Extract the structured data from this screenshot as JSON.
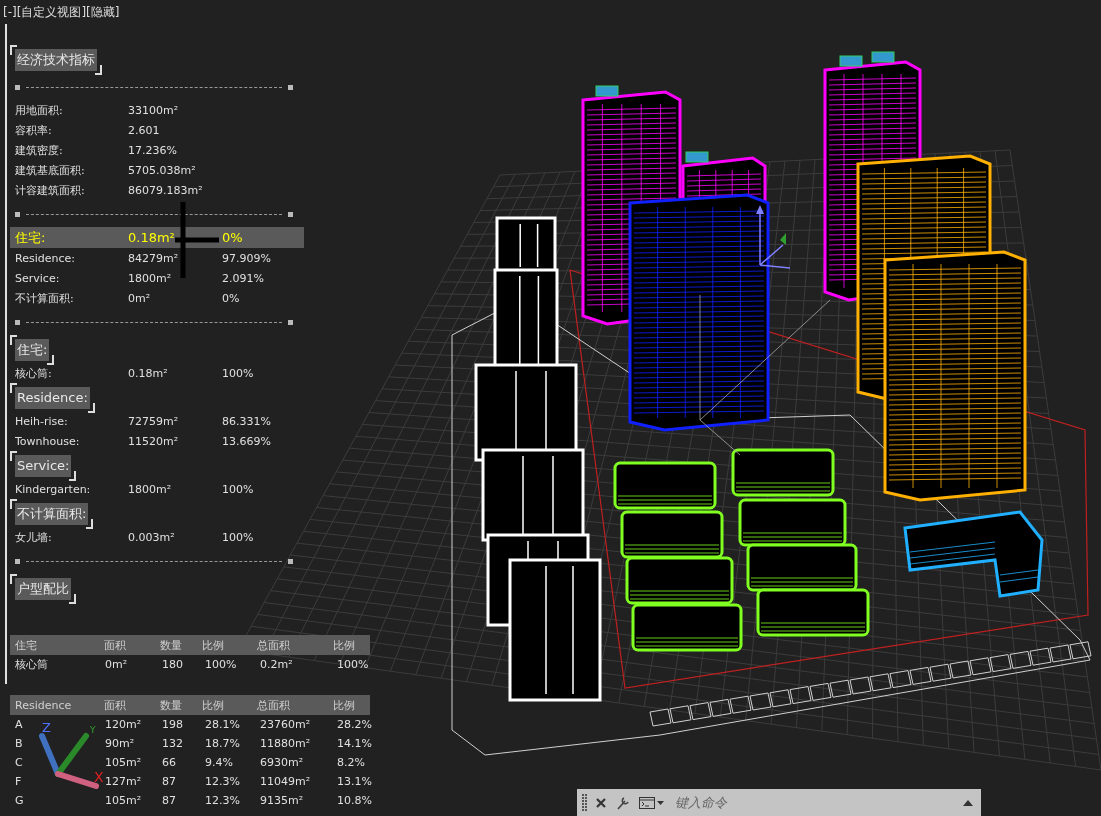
{
  "viewport_label": "[-][自定义视图][隐藏]",
  "blocks": [
    {
      "kind": "heading",
      "text": "经济技术指标"
    },
    {
      "kind": "divider"
    },
    {
      "kind": "row",
      "cells": [
        "用地面积:",
        "33100m²"
      ]
    },
    {
      "kind": "row",
      "cells": [
        "容积率:",
        "2.601"
      ]
    },
    {
      "kind": "row",
      "cells": [
        "建筑密度:",
        "17.236%"
      ]
    },
    {
      "kind": "row",
      "cells": [
        "建筑基底面积:",
        "5705.038m²"
      ]
    },
    {
      "kind": "row",
      "cells": [
        "计容建筑面积:",
        "86079.183m²"
      ]
    },
    {
      "kind": "divider"
    },
    {
      "kind": "highlight_row",
      "cells": [
        "住宅:",
        "0.18m²",
        "0%"
      ]
    },
    {
      "kind": "row",
      "cells": [
        "Residence:",
        "84279m²",
        "97.909%"
      ]
    },
    {
      "kind": "row",
      "cells": [
        "Service:",
        "1800m²",
        "2.091%"
      ]
    },
    {
      "kind": "row",
      "cells": [
        "不计算面积:",
        "0m²",
        "0%"
      ]
    },
    {
      "kind": "divider"
    },
    {
      "kind": "heading",
      "text": "住宅:"
    },
    {
      "kind": "row",
      "cells": [
        "核心筒:",
        "0.18m²",
        "100%"
      ]
    },
    {
      "kind": "heading",
      "text": "Residence:"
    },
    {
      "kind": "row",
      "cells": [
        "Heih-rise:",
        "72759m²",
        "86.331%"
      ]
    },
    {
      "kind": "row",
      "cells": [
        "Townhouse:",
        "11520m²",
        "13.669%"
      ]
    },
    {
      "kind": "heading",
      "text": "Service:"
    },
    {
      "kind": "row",
      "cells": [
        "Kindergarten:",
        "1800m²",
        "100%"
      ]
    },
    {
      "kind": "heading",
      "text": "不计算面积:"
    },
    {
      "kind": "row",
      "cells": [
        "女儿墙:",
        "0.003m²",
        "100%"
      ]
    },
    {
      "kind": "divider"
    },
    {
      "kind": "heading",
      "text": "户型配比"
    },
    {
      "kind": "table",
      "columns": [
        "住宅",
        "面积",
        "数量",
        "比例",
        "总面积",
        "比例"
      ],
      "rows": [
        [
          "核心筒",
          "0m²",
          "180",
          "100%",
          "0.2m²",
          "100%"
        ]
      ]
    },
    {
      "kind": "table",
      "columns": [
        "Residence",
        "面积",
        "数量",
        "比例",
        "总面积",
        "比例"
      ],
      "rows": [
        [
          "A",
          "120m²",
          "198",
          "28.1%",
          "23760m²",
          "28.2%"
        ],
        [
          "B",
          "90m²",
          "132",
          "18.7%",
          "11880m²",
          "14.1%"
        ],
        [
          "C",
          "105m²",
          "66",
          "9.4%",
          "6930m²",
          "8.2%"
        ],
        [
          "F",
          "127m²",
          "87",
          "12.3%",
          "11049m²",
          "13.1%"
        ],
        [
          "G",
          "105m²",
          "87",
          "12.3%",
          "9135m²",
          "10.8%"
        ]
      ]
    }
  ],
  "ucs_icon": {
    "z": "Z",
    "y": "Y",
    "x": "X"
  },
  "command_line": {
    "placeholder": "键入命令"
  }
}
